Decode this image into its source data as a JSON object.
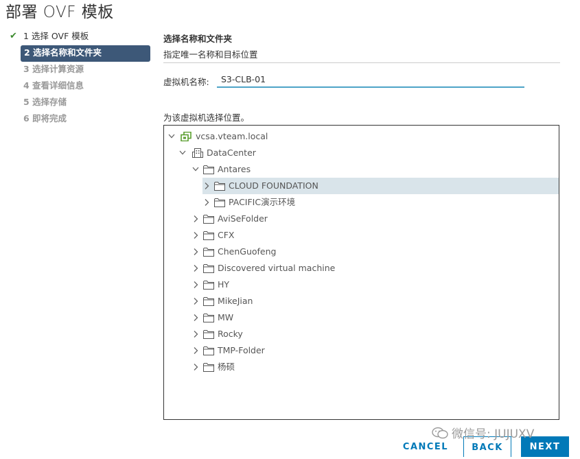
{
  "window": {
    "title": "部署 OVF 模板"
  },
  "steps": [
    {
      "label": "1 选择 OVF 模板",
      "state": "done"
    },
    {
      "label": "2 选择名称和文件夹",
      "state": "active"
    },
    {
      "label": "3 选择计算资源",
      "state": "pending"
    },
    {
      "label": "4 查看详细信息",
      "state": "pending"
    },
    {
      "label": "5 选择存储",
      "state": "pending"
    },
    {
      "label": "6 即将完成",
      "state": "pending"
    }
  ],
  "main": {
    "section_title": "选择名称和文件夹",
    "section_subtitle": "指定唯一名称和目标位置",
    "vm_name_label": "虚拟机名称:",
    "vm_name_value": "S3-CLB-01",
    "location_label": "为该虚拟机选择位置。"
  },
  "tree": [
    {
      "label": "vcsa.vteam.local",
      "icon": "vcenter-icon",
      "level": 0,
      "expanded": true,
      "selected": false
    },
    {
      "label": "DataCenter",
      "icon": "datacenter-icon",
      "level": 1,
      "expanded": true,
      "selected": false
    },
    {
      "label": "Antares",
      "icon": "folder-icon",
      "level": 2,
      "expanded": true,
      "selected": false
    },
    {
      "label": "CLOUD FOUNDATION",
      "icon": "folder-icon",
      "level": 3,
      "expanded": false,
      "selected": true
    },
    {
      "label": "PACIFIC演示环境",
      "icon": "folder-icon",
      "level": 3,
      "expanded": false,
      "selected": false
    },
    {
      "label": "AviSeFolder",
      "icon": "folder-icon",
      "level": 2,
      "expanded": false,
      "selected": false
    },
    {
      "label": "CFX",
      "icon": "folder-icon",
      "level": 2,
      "expanded": false,
      "selected": false
    },
    {
      "label": "ChenGuofeng",
      "icon": "folder-icon",
      "level": 2,
      "expanded": false,
      "selected": false
    },
    {
      "label": "Discovered virtual machine",
      "icon": "folder-icon",
      "level": 2,
      "expanded": false,
      "selected": false
    },
    {
      "label": "HY",
      "icon": "folder-icon",
      "level": 2,
      "expanded": false,
      "selected": false
    },
    {
      "label": "MikeJian",
      "icon": "folder-icon",
      "level": 2,
      "expanded": false,
      "selected": false
    },
    {
      "label": "MW",
      "icon": "folder-icon",
      "level": 2,
      "expanded": false,
      "selected": false
    },
    {
      "label": "Rocky",
      "icon": "folder-icon",
      "level": 2,
      "expanded": false,
      "selected": false
    },
    {
      "label": "TMP-Folder",
      "icon": "folder-icon",
      "level": 2,
      "expanded": false,
      "selected": false
    },
    {
      "label": "杨硕",
      "icon": "folder-icon",
      "level": 2,
      "expanded": false,
      "selected": false
    }
  ],
  "footer": {
    "cancel_label": "CANCEL",
    "back_label": "BACK",
    "next_label": "NEXT"
  },
  "watermark": {
    "text": "微信号: JUJUXV"
  },
  "colors": {
    "accent": "#0079b8",
    "active_step": "#3d5878",
    "selected_row": "#d9e4ea",
    "check": "#3c8a2e",
    "input_underline": "#4da3c7"
  }
}
